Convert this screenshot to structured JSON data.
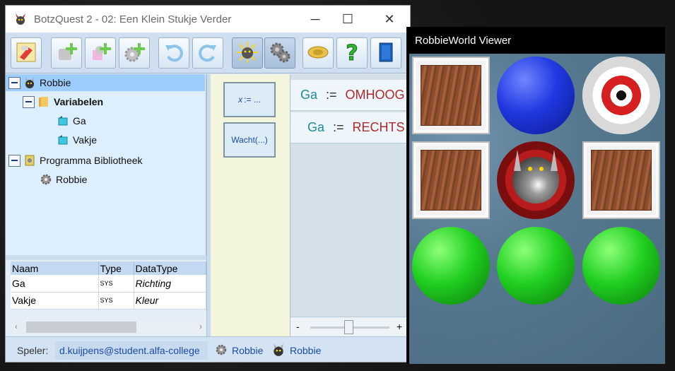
{
  "main_window": {
    "title": "BotzQuest 2 - 02: Een Klein Stukje Verder",
    "controls": {
      "minimize": "─",
      "maximize": "☐",
      "close": "✕"
    }
  },
  "toolbar": {
    "buttons": [
      {
        "name": "edit-robot-button",
        "icon": "robot-edit-icon"
      },
      {
        "name": "add-robot-button",
        "icon": "robot-add-icon"
      },
      {
        "name": "add-module-button",
        "icon": "module-add-icon"
      },
      {
        "name": "add-gear-button",
        "icon": "gear-add-icon"
      },
      {
        "name": "undo-button",
        "icon": "undo-icon"
      },
      {
        "name": "redo-button",
        "icon": "redo-icon"
      },
      {
        "name": "run-button",
        "icon": "sun-icon",
        "active": true
      },
      {
        "name": "settings-button",
        "icon": "gears-icon",
        "active": true
      },
      {
        "name": "badge-button",
        "icon": "badge-icon"
      },
      {
        "name": "help-button",
        "icon": "question-icon"
      },
      {
        "name": "exit-button",
        "icon": "door-icon"
      }
    ]
  },
  "tree": {
    "root_label": "Robbie",
    "variables_label": "Variabelen",
    "variables": [
      "Ga",
      "Vakje"
    ],
    "library_label": "Programma Bibliotheek",
    "library_items": [
      "Robbie"
    ]
  },
  "variables_table": {
    "headers": [
      "Naam",
      "Type",
      "DataType"
    ],
    "rows": [
      {
        "naam": "Ga",
        "type": "SYS",
        "datatype": "Richting"
      },
      {
        "naam": "Vakje",
        "type": "SYS",
        "datatype": "Kleur"
      }
    ]
  },
  "status": {
    "player_label": "Speler:",
    "player_value": "d.kuijpens@student.alfa-college",
    "tab1_label": "Robbie",
    "tab2_label": "Robbie"
  },
  "blocks": {
    "assign_var": "x",
    "assign_op": ":= ...",
    "wait": "Wacht(...)"
  },
  "program": {
    "lines": [
      {
        "var": "Ga",
        "op": ":=",
        "value": "OMHOOG"
      },
      {
        "var": "Ga",
        "op": ":=",
        "value": "RECHTS"
      }
    ],
    "zoom_minus": "-",
    "zoom_plus": "+"
  },
  "viewer": {
    "title": "RobbieWorld Viewer",
    "grid": [
      [
        "box",
        "blue-ball",
        "target"
      ],
      [
        "box",
        "robot",
        "box"
      ],
      [
        "green-ball",
        "green-ball",
        "green-ball"
      ]
    ]
  },
  "colors": {
    "variable_teal": "#1f8a9a",
    "value_red": "#b02a2a",
    "block_text": "#1a4ba8",
    "selection": "#9ccdfc"
  }
}
